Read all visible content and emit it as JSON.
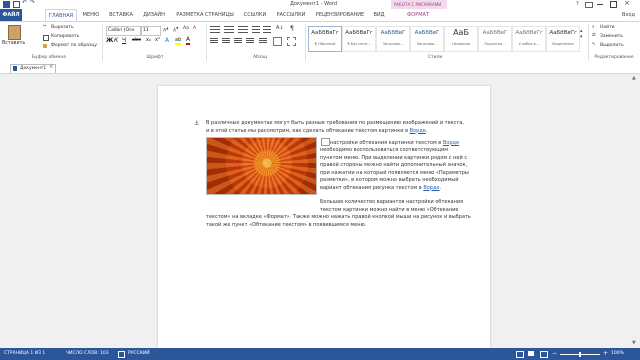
{
  "window": {
    "title": "Документ1 - Word",
    "help": "?"
  },
  "tabs": [
    "ФАЙЛ",
    "ГЛАВНАЯ",
    "МЕНЮ",
    "ВСТАВКА",
    "ДИЗАЙН",
    "РАЗМЕТКА СТРАНИЦЫ",
    "ССЫЛКИ",
    "РАССЫЛКИ",
    "РЕЦЕНЗИРОВАНИЕ",
    "ВИД",
    "ФОРМАТ"
  ],
  "context_tab_group": "РАБОТА С РИСУНКАМИ",
  "user": "Вход",
  "clipboard": {
    "paste": "Вставить",
    "cut": "Вырезать",
    "copy": "Копировать",
    "format_painter": "Формат по образцу",
    "label": "Буфер обмена"
  },
  "font": {
    "name": "Calibri (Осн",
    "size": "11",
    "label": "Шрифт"
  },
  "paragraph": {
    "label": "Абзац"
  },
  "styles": {
    "items": [
      {
        "sample": "АаБбВвГг",
        "name": "¶ Обычный"
      },
      {
        "sample": "АаБбВвГг",
        "name": "¶ Без инте..."
      },
      {
        "sample": "АаБбВвГ",
        "name": "Заголово..."
      },
      {
        "sample": "АаБбВвГ",
        "name": "Заголово..."
      },
      {
        "sample": "АаБ",
        "name": "Название"
      },
      {
        "sample": "АаБбВвГ",
        "name": "Подзагол..."
      },
      {
        "sample": "АаБбВвГг",
        "name": "Слабое в..."
      },
      {
        "sample": "АаБбВвГг",
        "name": "Выделение"
      }
    ],
    "label": "Стили"
  },
  "editing": {
    "find": "Найти",
    "replace": "Заменить",
    "select": "Выделить",
    "label": "Редактирование"
  },
  "doc_tab": "Документ1",
  "document": {
    "line1_a": "В различных документах могут быть разные требования по размещению изображений и текста,",
    "line2_a": "и в этой статье мы рассмотрим, как сделать обтекание текстом картинки в ",
    "line2_link": "Ворде",
    "wrap_lines": [
      {
        "pre": "настройки обтекания картинки текстом в ",
        "link": "Ворде"
      },
      {
        "pre": "необходимо воспользоваться соответствующим",
        "link": ""
      },
      {
        "pre": "пунктом меню. При выделении картинки рядом с ней с",
        "link": ""
      },
      {
        "pre": "правой стороны можно найти дополнительный значок,",
        "link": ""
      },
      {
        "pre": "при нажатии на который появляется меню «Параметры",
        "link": ""
      },
      {
        "pre": "разметки», в котором можно выбрать необходимый",
        "link": ""
      },
      {
        "pre": "вариант обтекания рисунка текстом в ",
        "link": "Ворде"
      }
    ],
    "para2_lines": [
      "Большее количество вариантов настройки обтекания",
      "текстом картинки можно найти в меню «Обтекание",
      "текстом» на вкладке «Формат». Также можно нажать правой кнопкой мыши на рисунок и выбрать",
      "такой же пункт «Обтекание текстом» в появившемся меню."
    ]
  },
  "status": {
    "page": "СТРАНИЦА 1 ИЗ 1",
    "words": "ЧИСЛО СЛОВ: 103",
    "lang": "РУССКИЙ",
    "zoom": "100%"
  },
  "colors": {
    "word_blue": "#2b579a",
    "context_purple": "#9a3d88",
    "flower_orange": "#e2591a"
  }
}
